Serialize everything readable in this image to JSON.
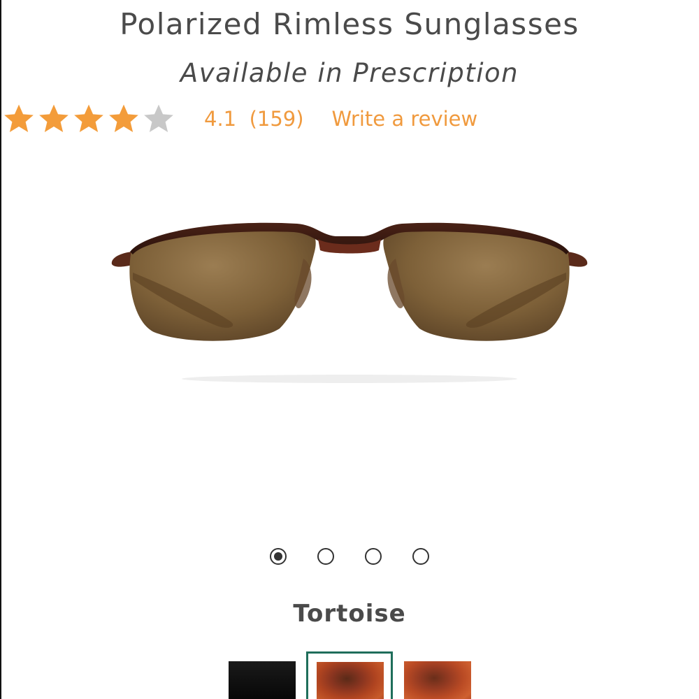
{
  "product": {
    "title": "Polarized Rimless Sunglasses",
    "subtitle": "Available in Prescription"
  },
  "rating": {
    "value": "4.1",
    "count": "(159)",
    "stars_filled": 4,
    "stars_total": 5,
    "write_review_label": "Write a review",
    "star_color": "#f39c3a",
    "empty_star_color": "#c8c8c8",
    "text_color": "#f09a3e"
  },
  "gallery": {
    "image_alt": "product-image",
    "dots_total": 4,
    "active_dot": 1
  },
  "color_selector": {
    "selected_color_name": "Tortoise",
    "swatches": [
      {
        "name": "black",
        "selected": false
      },
      {
        "name": "tortoise",
        "selected": true
      },
      {
        "name": "tortoise",
        "selected": false
      }
    ],
    "selected_border_color": "#1f6e5b"
  }
}
